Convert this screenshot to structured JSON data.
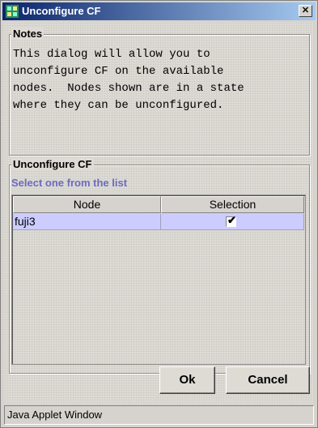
{
  "window": {
    "title": "Unconfigure CF",
    "close_label": "✕"
  },
  "notes": {
    "legend": "Notes",
    "text": "This dialog will allow you to\nunconfigure CF on the available\nnodes.  Nodes shown are in a state\nwhere they can be unconfigured."
  },
  "unconfigure": {
    "legend": "Unconfigure CF",
    "prompt": "Select one from the list",
    "columns": [
      "Node",
      "Selection"
    ],
    "rows": [
      {
        "node": "fuji3",
        "selected": true,
        "check_glyph": "✔"
      }
    ]
  },
  "buttons": {
    "ok": "Ok",
    "cancel": "Cancel"
  },
  "status": {
    "text": "Java Applet Window"
  },
  "colors": {
    "title_bar": "#0a246a",
    "selected_row": "#ccccff",
    "prompt_text": "#6b6bbf"
  }
}
